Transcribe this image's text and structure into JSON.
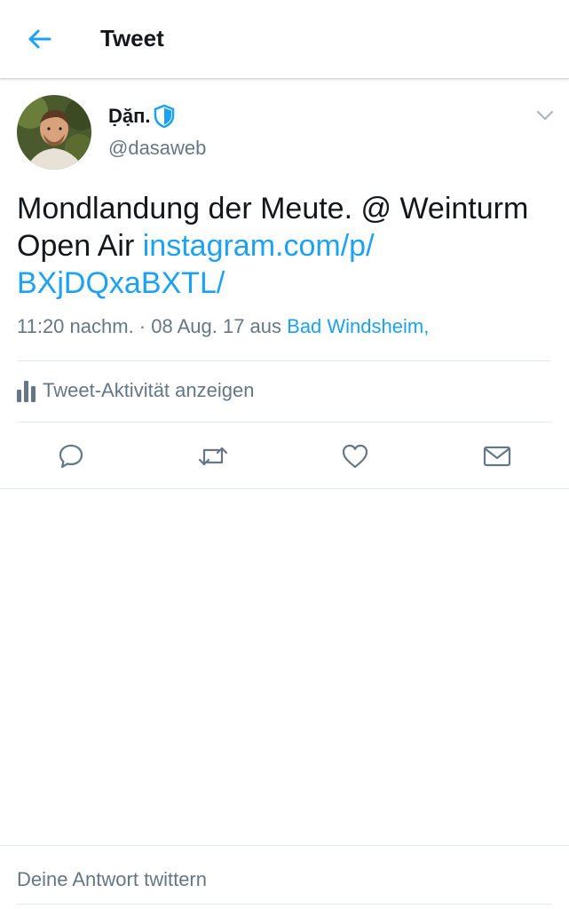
{
  "header": {
    "title": "Tweet"
  },
  "user": {
    "display_name": "Ḍặп.",
    "handle": "@dasaweb"
  },
  "tweet": {
    "text": "Mondlandung der Meute. @ Weinturm Open Air ",
    "link": "instagram.com/p/ BXjDQxaBXTL/",
    "meta_time": "11:20 nachm. · 08 Aug. 17 aus ",
    "meta_place": "Bad Windsheim,"
  },
  "activity": {
    "label": "Tweet-Aktivität anzeigen"
  },
  "actions": [
    "reply-icon",
    "retweet-icon",
    "like-icon",
    "share-icon"
  ],
  "reply_bar": {
    "placeholder": "Deine Antwort twittern"
  },
  "colors": {
    "accent": "#1da1f2",
    "secondary_text": "#657786",
    "primary_text": "#14171a",
    "divider": "#e1e8ed"
  }
}
